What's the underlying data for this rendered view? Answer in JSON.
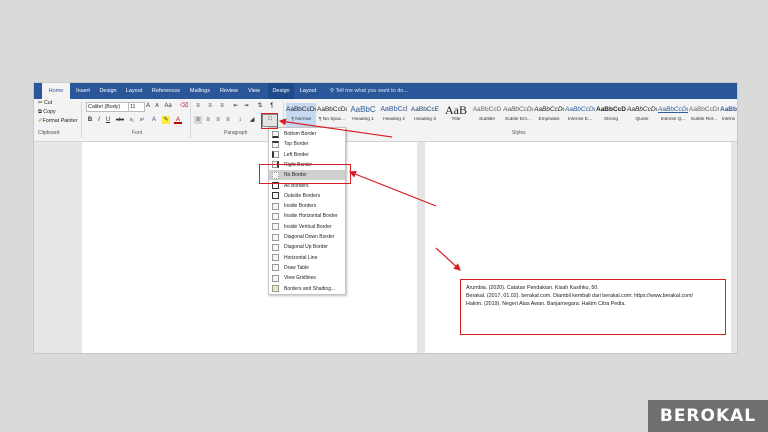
{
  "tabs": [
    "Home",
    "Insert",
    "Design",
    "Layout",
    "References",
    "Mailings",
    "Review",
    "View",
    "Design",
    "Layout"
  ],
  "tell_me": "Tell me what you want to do...",
  "clipboard": {
    "paste": "Paste",
    "cut": "Cut",
    "copy": "Copy",
    "format_painter": "Format Painter",
    "group": "Clipboard"
  },
  "font": {
    "name": "Calibri (Body)",
    "size": "11",
    "group": "Font",
    "bold": "B",
    "italic": "I",
    "underline": "U",
    "strike": "abc",
    "sub": "x₂",
    "sup": "x²"
  },
  "paragraph": {
    "group": "Paragraph"
  },
  "styles": {
    "group": "Styles",
    "items": [
      {
        "sample": "AaBbCcDc",
        "name": "¶ Normal"
      },
      {
        "sample": "AaBbCcDc",
        "name": "¶ No Spac..."
      },
      {
        "sample": "AaBbC",
        "name": "Heading 1"
      },
      {
        "sample": "AaBbCcl",
        "name": "Heading 2"
      },
      {
        "sample": "AaBbCcE",
        "name": "Heading 3"
      },
      {
        "sample": "AaB",
        "name": "Title"
      },
      {
        "sample": "AaBbCcD",
        "name": "Subtitle"
      },
      {
        "sample": "AaBbCcDc",
        "name": "Subtle Em..."
      },
      {
        "sample": "AaBbCcDc",
        "name": "Emphasis"
      },
      {
        "sample": "AaBbCcDc",
        "name": "Intense E..."
      },
      {
        "sample": "AaBbCcDc",
        "name": "Strong"
      },
      {
        "sample": "AaBbCcDc",
        "name": "Quote"
      },
      {
        "sample": "AaBbCcDc",
        "name": "Intense Q..."
      },
      {
        "sample": "AaBbCcDC",
        "name": "Subtle Ref..."
      },
      {
        "sample": "AaBb",
        "name": "Intens"
      }
    ]
  },
  "border_menu": [
    {
      "label": "Bottom Border"
    },
    {
      "label": "Top Border"
    },
    {
      "label": "Left Border"
    },
    {
      "label": "Right Border"
    },
    {
      "label": "No Border"
    },
    {
      "label": "All Borders"
    },
    {
      "label": "Outside Borders"
    },
    {
      "label": "Inside Borders"
    },
    {
      "label": "Inside Horizontal Border"
    },
    {
      "label": "Inside Vertical Border"
    },
    {
      "label": "Diagonal Down Border"
    },
    {
      "label": "Diagonal Up Border"
    },
    {
      "label": "Horizontal Line"
    },
    {
      "label": "Draw Table"
    },
    {
      "label": "View Gridlines"
    },
    {
      "label": "Borders and Shading..."
    }
  ],
  "references": [
    "Arumbia. (2020). Catatan Pendakian. Kisah Kasihku, 50.",
    "Berakal. (2017, 01.02). berakal.com. Diambil kembali dari berakal.com: https://www.berakal.com/",
    "Hakim. (2019). Negeri Atas Awan. Banjarnegara: Hakim Citra Pedia."
  ],
  "watermark": "BEROKAL",
  "colors": {
    "accent": "#2b579a",
    "highlight": "#d81f26"
  }
}
